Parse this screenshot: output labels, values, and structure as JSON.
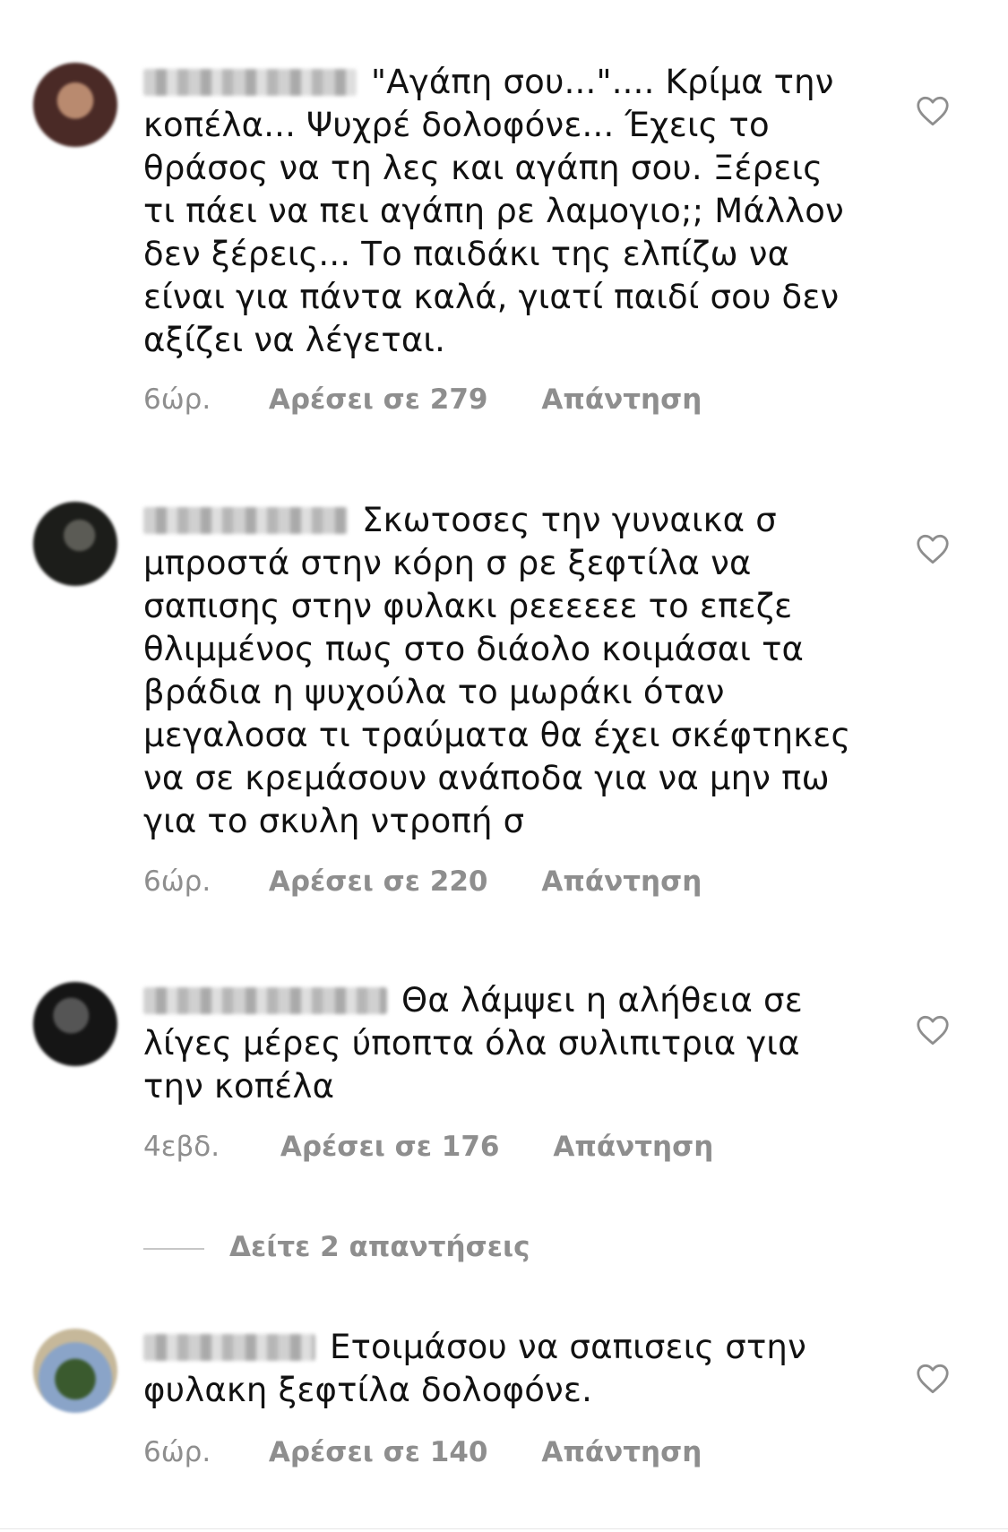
{
  "comments": [
    {
      "text": "\"Αγάπη σου...\".... Κρίμα την κοπέλα... Ψυχρέ δολοφόνε... Έχεις το θράσος να τη λες και αγάπη σου. Ξέρεις τι πάει να πει αγάπη ρε λαμογιο;; Μάλλον δεν ξέρεις... Το παιδάκι της ελπίζω να είναι για πάντα καλά, γιατί παιδί σου δεν αξίζει να λέγεται.",
      "time": "6ώρ.",
      "likes": "Αρέσει σε 279",
      "reply": "Απάντηση"
    },
    {
      "text": "Σκωτοσες την γυναικα σ μπροστά στην κόρη σ ρε ξεφτίλα να σαπισης στην φυλακι ρεεεεεε το επεζε θλιμμένος πως στο διάολο κοιμάσαι τα βράδια η ψυχούλα το μωράκι όταν μεγαλοσα τι τραύματα θα έχει σκέφτηκες να σε κρεμάσουν ανάποδα για να μην πω για το σκυλη ντροπή σ",
      "time": "6ώρ.",
      "likes": "Αρέσει σε 220",
      "reply": "Απάντηση"
    },
    {
      "text": "Θα λάμψει η αλήθεια σε λίγες μέρες ύποπτα όλα συλιπιτρια για την κοπέλα",
      "time": "4εβδ.",
      "likes": "Αρέσει σε 176",
      "reply": "Απάντηση"
    },
    {
      "text": "Ετοιμάσου να σαπισεις στην φυλακη ξεφτίλα δολοφόνε.",
      "time": "6ώρ.",
      "likes": "Αρέσει σε 140",
      "reply": "Απάντηση"
    }
  ],
  "view_replies": "Δείτε 2 απαντήσεις",
  "icons": {
    "like": "heart-outline-icon"
  },
  "colors": {
    "text": "#111111",
    "meta": "#8e8e8e",
    "background": "#ffffff"
  }
}
